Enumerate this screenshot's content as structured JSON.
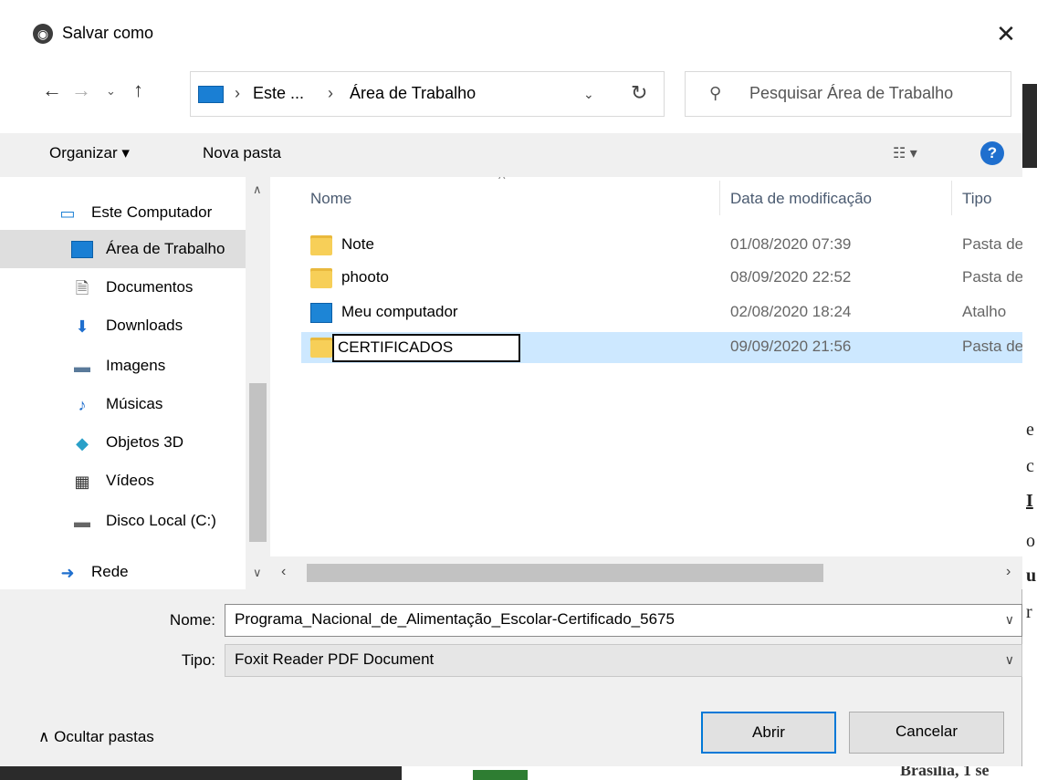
{
  "dialog": {
    "title": "Salvar como",
    "close": "✕"
  },
  "nav": {
    "back": "←",
    "forward": "→",
    "recent": "⌄",
    "up": "↑",
    "refresh": "↻"
  },
  "address": {
    "parts": [
      "Este ...",
      "›",
      "Área de Trabalho"
    ],
    "chevron": "›",
    "dropdown": "⌄"
  },
  "search": {
    "placeholder": "Pesquisar Área de Trabalho"
  },
  "toolbar": {
    "organize": "Organizar ▾",
    "new_folder": "Nova pasta",
    "view": "☷ ▾",
    "help": "?"
  },
  "sidebar": {
    "items": [
      {
        "label": "Este Computador",
        "icon": "computer-icon",
        "glyph": "🖥"
      },
      {
        "label": "Área de Trabalho",
        "icon": "desktop-icon",
        "glyph": "▭",
        "selected": true
      },
      {
        "label": "Documentos",
        "icon": "documents-icon",
        "glyph": "🗎"
      },
      {
        "label": "Downloads",
        "icon": "downloads-icon",
        "glyph": "⬇"
      },
      {
        "label": "Imagens",
        "icon": "pictures-icon",
        "glyph": "▬"
      },
      {
        "label": "Músicas",
        "icon": "music-icon",
        "glyph": "♪"
      },
      {
        "label": "Objetos 3D",
        "icon": "objects-3d-icon",
        "glyph": "◆"
      },
      {
        "label": "Vídeos",
        "icon": "videos-icon",
        "glyph": "▦"
      },
      {
        "label": "Disco Local (C:)",
        "icon": "drive-icon",
        "glyph": "▬"
      },
      {
        "label": "Rede",
        "icon": "network-icon",
        "glyph": "➜"
      }
    ]
  },
  "filelist": {
    "columns": [
      "Nome",
      "Data de modificação",
      "Tipo"
    ],
    "rows": [
      {
        "name": "Note",
        "date": "01/08/2020 07:39",
        "type": "Pasta de",
        "icon": "folder-icon"
      },
      {
        "name": "phooto",
        "date": "08/09/2020 22:52",
        "type": "Pasta de",
        "icon": "folder-icon"
      },
      {
        "name": "Meu computador",
        "date": "02/08/2020 18:24",
        "type": "Atalho",
        "icon": "shortcut-icon"
      },
      {
        "name": "CERTIFICADOS",
        "date": "09/09/2020 21:56",
        "type": "Pasta de",
        "icon": "folder-icon",
        "selected": true,
        "editing": true
      }
    ]
  },
  "form": {
    "name_label": "Nome:",
    "name_value": "Programa_Nacional_de_Alimentação_Escolar-Certificado_5675",
    "type_label": "Tipo:",
    "type_value": "Foxit Reader PDF Document"
  },
  "footer": {
    "hide_folders": "∧  Ocultar pastas",
    "open": "Abrir",
    "cancel": "Cancelar"
  },
  "background": {
    "text": [
      "e",
      "c",
      "I",
      "o",
      "u",
      "r"
    ],
    "bottom_text": "Brasília, 1 se"
  }
}
